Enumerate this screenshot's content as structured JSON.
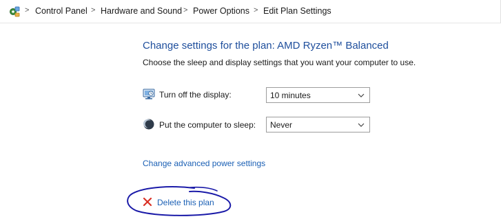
{
  "breadcrumb": {
    "items": [
      "Control Panel",
      "Hardware and Sound",
      "Power Options",
      "Edit Plan Settings"
    ],
    "separator": ">"
  },
  "main": {
    "title": "Change settings for the plan: AMD Ryzen™ Balanced",
    "subtitle": "Choose the sleep and display settings that you want your computer to use.",
    "settings": [
      {
        "label": "Turn off the display:",
        "value": "10 minutes",
        "icon": "display-icon"
      },
      {
        "label": "Put the computer to sleep:",
        "value": "Never",
        "icon": "moon-icon"
      }
    ],
    "advanced_link": "Change advanced power settings",
    "delete_link": "Delete this plan"
  },
  "colors": {
    "title": "#1e4e9c",
    "link": "#1a5fb4",
    "delete_icon": "#d93025",
    "annotation": "#1a1aa8"
  }
}
